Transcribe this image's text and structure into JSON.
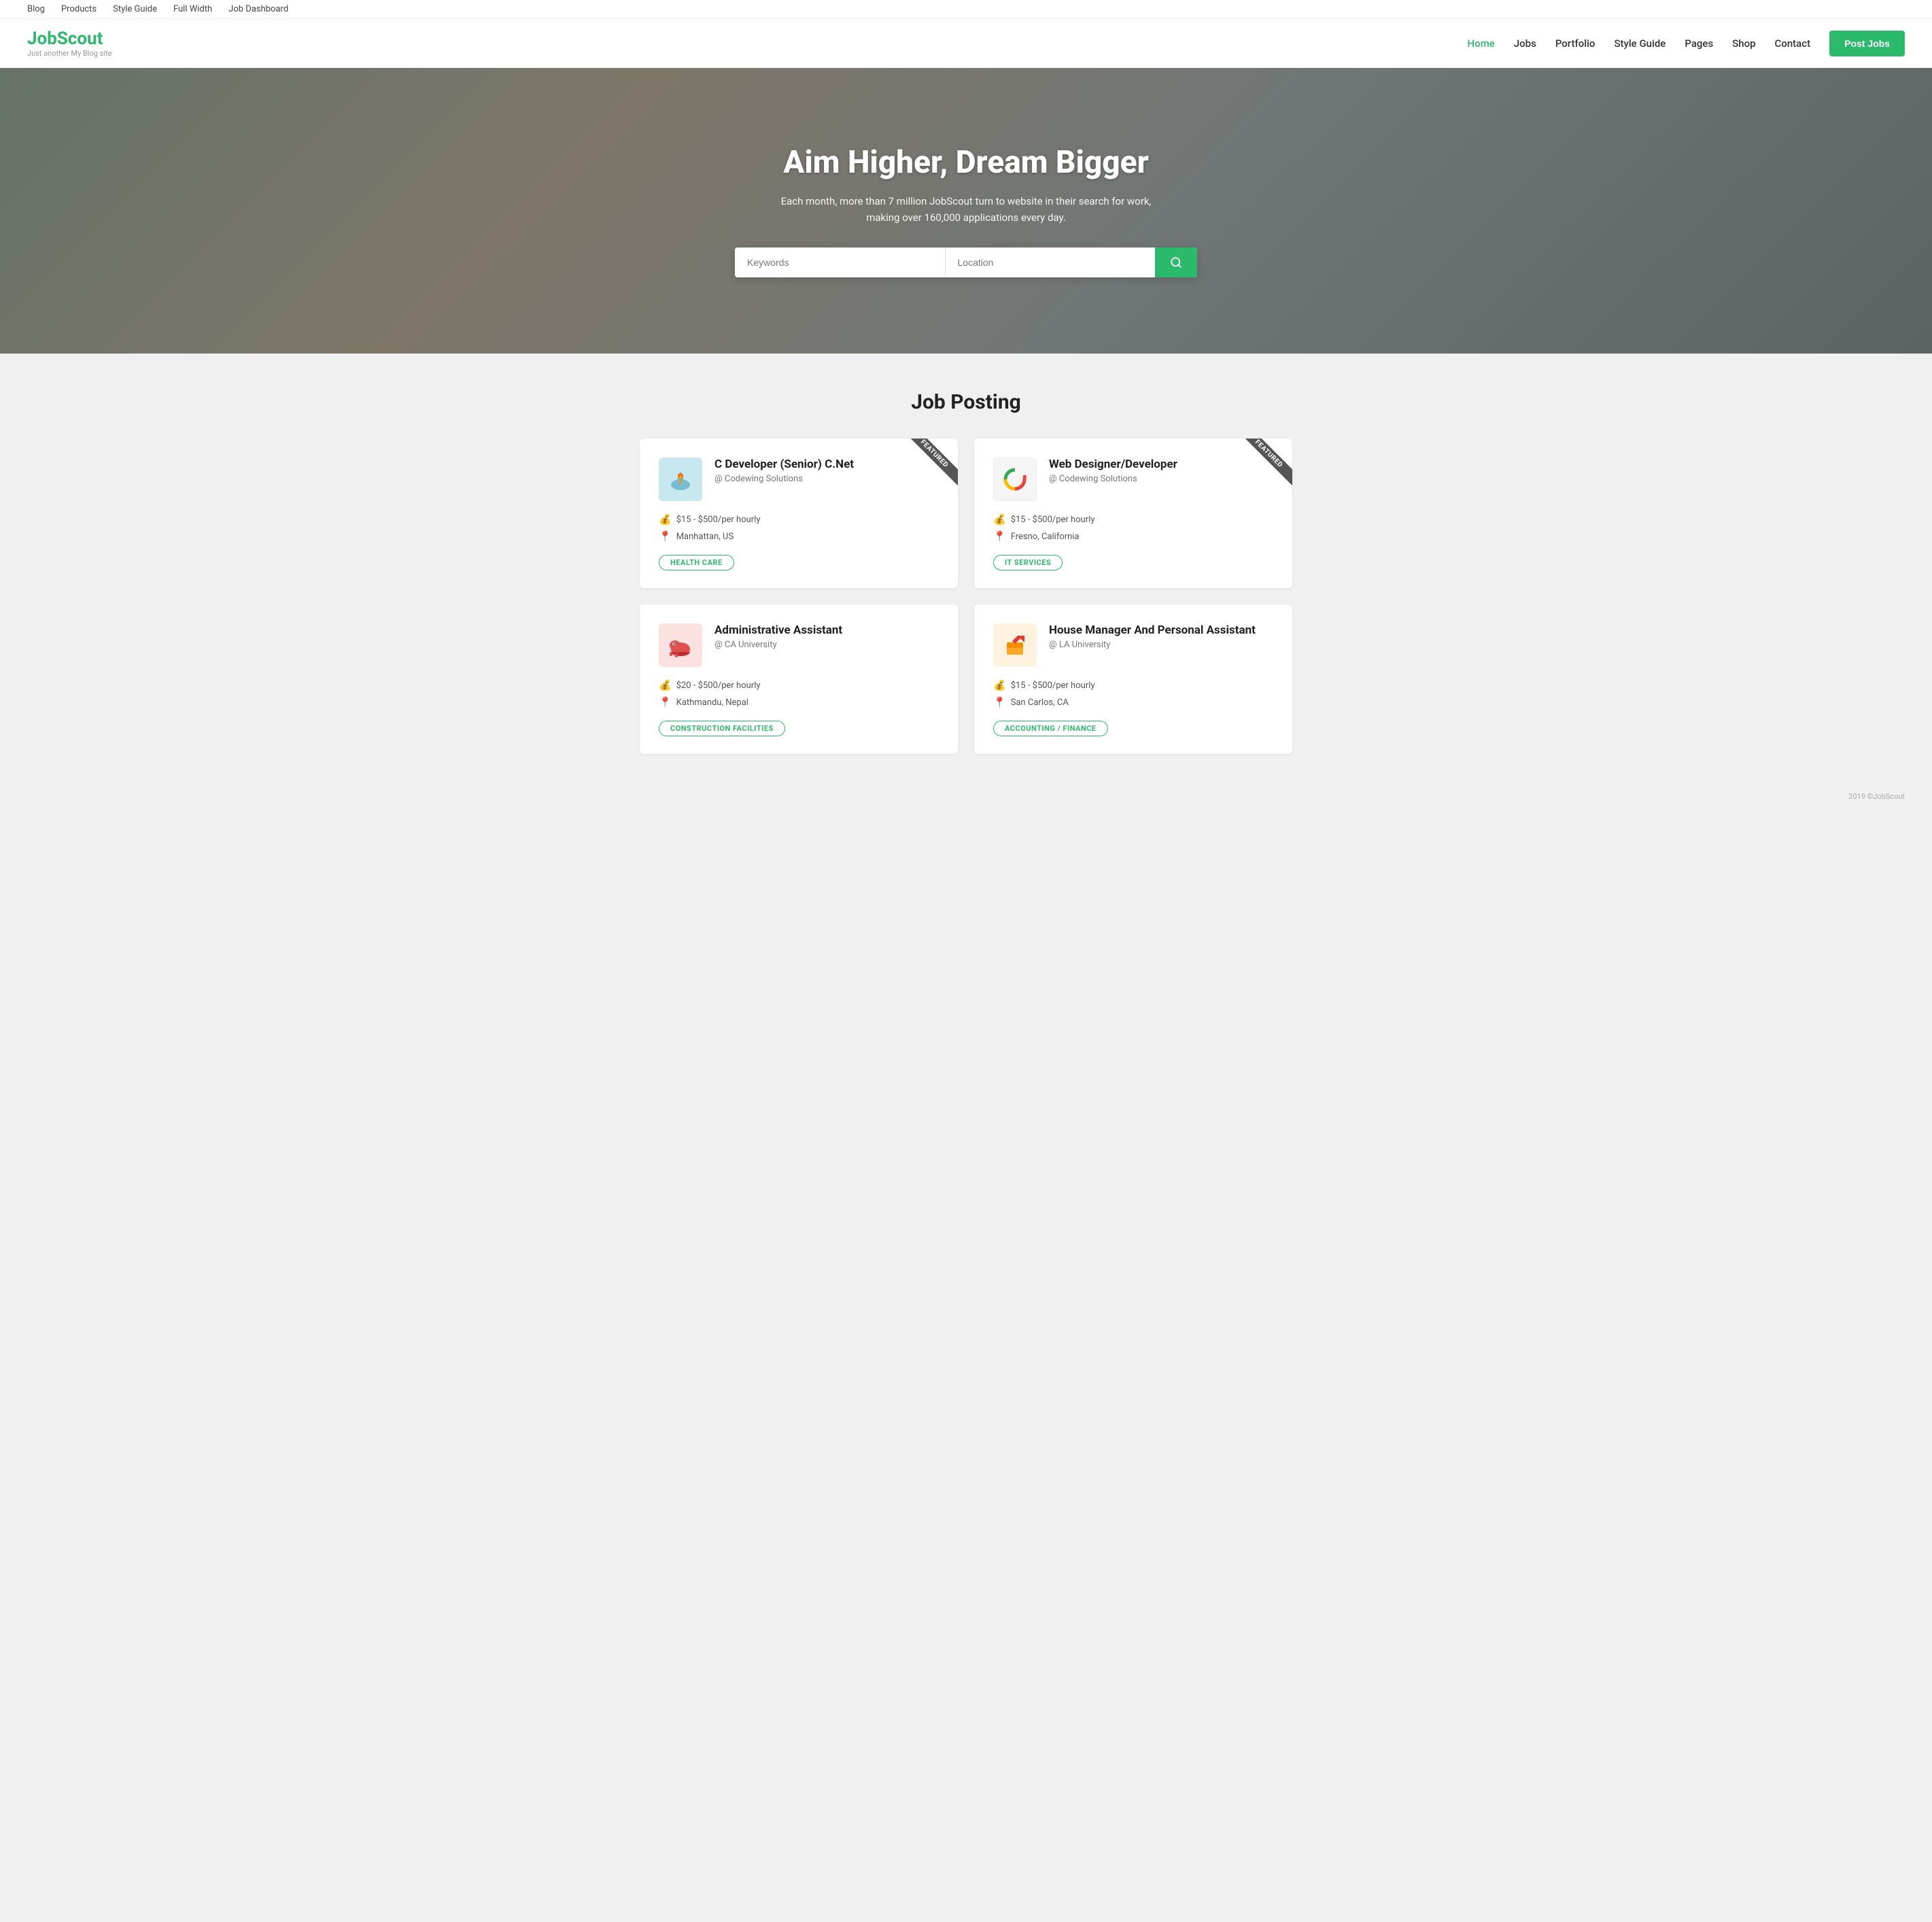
{
  "topbar": {
    "links": [
      "Blog",
      "Products",
      "Style Guide",
      "Full Width",
      "Job Dashboard"
    ]
  },
  "nav": {
    "logo": "JobScout",
    "tagline": "Just another My Blog site",
    "links": [
      {
        "label": "Home",
        "active": true
      },
      {
        "label": "Jobs",
        "active": false
      },
      {
        "label": "Portfolio",
        "active": false
      },
      {
        "label": "Style Guide",
        "active": false
      },
      {
        "label": "Pages",
        "active": false
      },
      {
        "label": "Shop",
        "active": false
      },
      {
        "label": "Contact",
        "active": false
      }
    ],
    "post_jobs_label": "Post Jobs"
  },
  "hero": {
    "heading": "Aim Higher, Dream Bigger",
    "subtext": "Each month, more than 7 million JobScout turn to website in their search for work, making over 160,000 applications every day.",
    "keywords_placeholder": "Keywords",
    "location_placeholder": "Location"
  },
  "jobs_section": {
    "title": "Job Posting",
    "jobs": [
      {
        "id": 1,
        "title": "C Developer (Senior) C.Net",
        "company": "@ Codewing Solutions",
        "salary": "$15 - $500/per hourly",
        "location": "Manhattan, US",
        "tag": "HEALTH CARE",
        "featured": true,
        "logo_color": "#b8dde6",
        "logo_type": "flame"
      },
      {
        "id": 2,
        "title": "Web Designer/Developer",
        "company": "@ Codewing Solutions",
        "salary": "$15 - $500/per hourly",
        "location": "Fresno, California",
        "tag": "IT SERVICES",
        "featured": true,
        "logo_color": "#fff",
        "logo_type": "c-letter"
      },
      {
        "id": 3,
        "title": "Administrative Assistant",
        "company": "@ CA University",
        "salary": "$20 - $500/per hourly",
        "location": "Kathmandu, Nepal",
        "tag": "CONSTRUCTION FACILITIES",
        "featured": false,
        "logo_color": "#f5c5c5",
        "logo_type": "dino"
      },
      {
        "id": 4,
        "title": "House Manager And Personal Assistant",
        "company": "@ LA University",
        "salary": "$15 - $500/per hourly",
        "location": "San Carlos, CA",
        "tag": "ACCOUNTING / FINANCE",
        "featured": false,
        "logo_color": "#fff3e0",
        "logo_type": "box"
      }
    ]
  },
  "footer": {
    "text": "2019 ©JobScout"
  }
}
